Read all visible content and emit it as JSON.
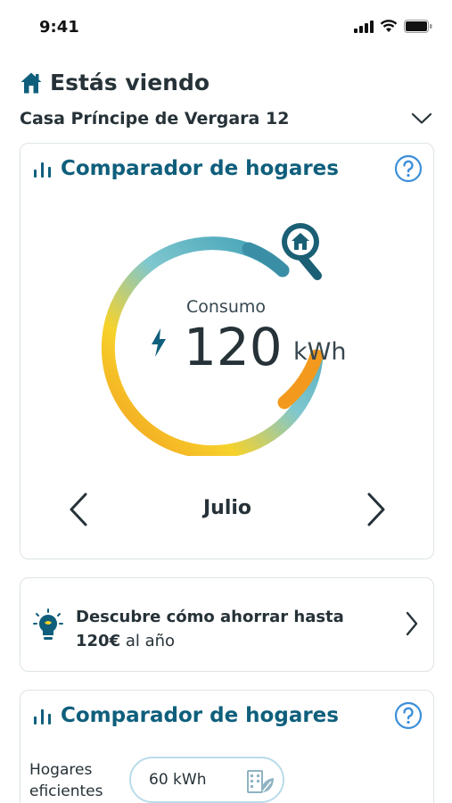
{
  "status": {
    "time": "9:41"
  },
  "viewing": {
    "title": "Estás viendo",
    "home": "Casa Príncipe de Vergara 12"
  },
  "comparator": {
    "title": "Comparador de hogares",
    "consumption_label": "Consumo",
    "consumption_value": "120",
    "consumption_unit": "kWh",
    "month": "Julio"
  },
  "savings": {
    "line1": "Descubre cómo ahorrar hasta",
    "amount": "120€",
    "suffix": " al año"
  },
  "comparator2": {
    "title": "Comparador de hogares",
    "efficient_label": "Hogares eficientes",
    "efficient_value": "60 kWh"
  },
  "colors": {
    "accent": "#0f5f7c",
    "help": "#3b8fd9",
    "gauge_start": "#f39a1e",
    "gauge_mid": "#f6d22b",
    "gauge_end": "#2f96ae"
  }
}
